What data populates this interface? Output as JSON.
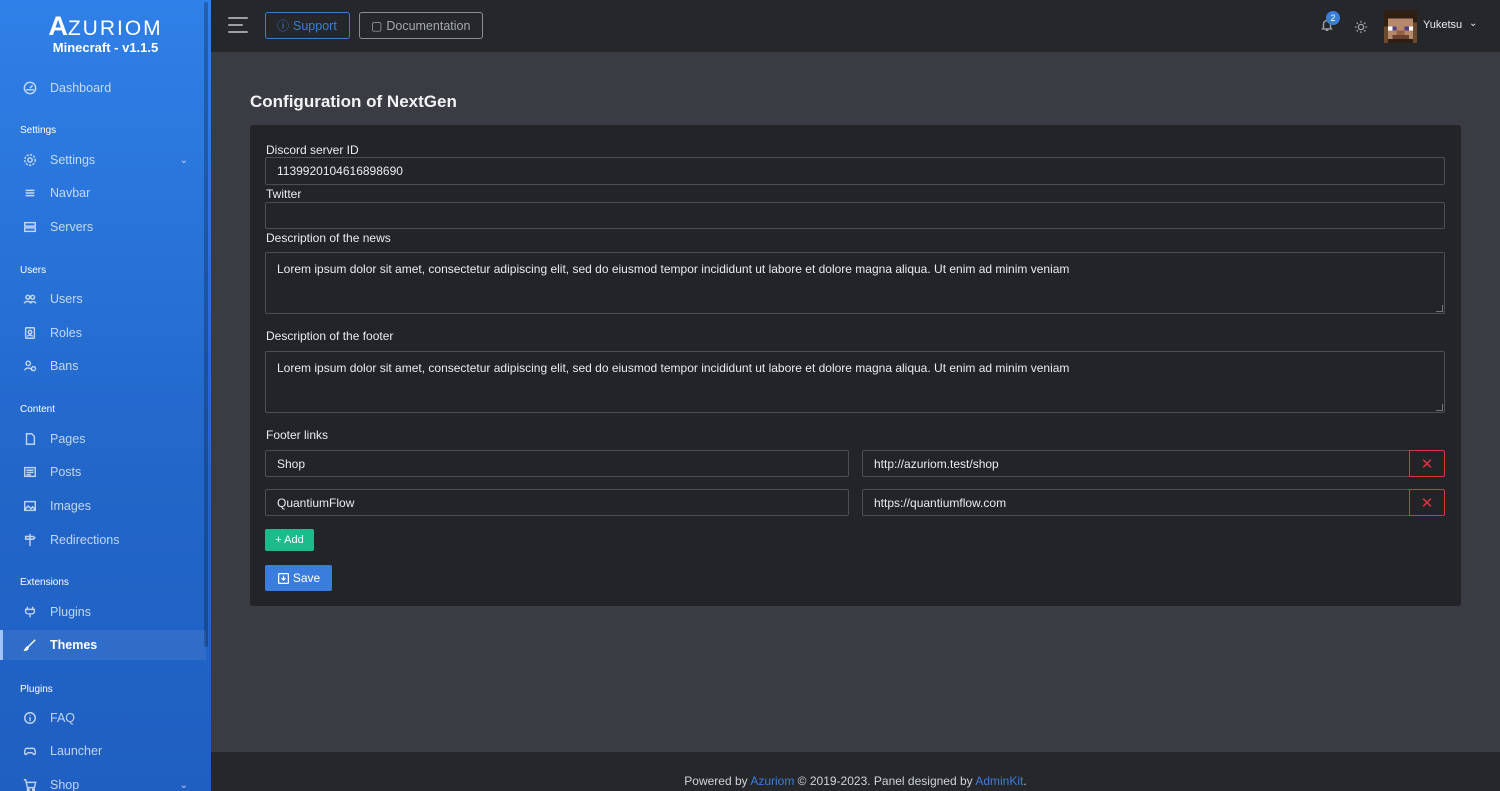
{
  "brand": {
    "logo_first": "A",
    "logo_rest": "ZURIOM",
    "version": "Minecraft - v1.1.5"
  },
  "sidebar": {
    "headers": {
      "settings": "Settings",
      "users": "Users",
      "content": "Content",
      "extensions": "Extensions",
      "plugins": "Plugins"
    },
    "items": [
      {
        "label": "Dashboard",
        "icon": "speedometer-icon"
      },
      {
        "label": "Settings",
        "icon": "gear-icon"
      },
      {
        "label": "Navbar",
        "icon": "list-icon"
      },
      {
        "label": "Servers",
        "icon": "server-icon"
      },
      {
        "label": "Users",
        "icon": "people-icon"
      },
      {
        "label": "Roles",
        "icon": "person-badge-icon"
      },
      {
        "label": "Bans",
        "icon": "person-x-icon"
      },
      {
        "label": "Pages",
        "icon": "file-icon"
      },
      {
        "label": "Posts",
        "icon": "newspaper-icon"
      },
      {
        "label": "Images",
        "icon": "image-icon"
      },
      {
        "label": "Redirections",
        "icon": "signpost-icon"
      },
      {
        "label": "Plugins",
        "icon": "plug-icon"
      },
      {
        "label": "Themes",
        "icon": "brush-icon"
      },
      {
        "label": "FAQ",
        "icon": "info-icon"
      },
      {
        "label": "Launcher",
        "icon": "controller-icon"
      },
      {
        "label": "Shop",
        "icon": "cart-icon"
      }
    ]
  },
  "topbar": {
    "support_label": "Support",
    "documentation_label": "Documentation",
    "notification_count": "2",
    "username": "Yuketsu"
  },
  "main": {
    "title": "Configuration of NextGen",
    "discord_label": "Discord server ID",
    "discord_value": "1139920104616898690",
    "twitter_label": "Twitter",
    "twitter_value": "",
    "news_label": "Description of the news",
    "news_value": "Lorem ipsum dolor sit amet, consectetur adipiscing elit, sed do eiusmod tempor incididunt ut labore et dolore magna aliqua. Ut enim ad minim veniam",
    "footer_desc_label": "Description of the footer",
    "footer_desc_value": "Lorem ipsum dolor sit amet, consectetur adipiscing elit, sed do eiusmod tempor incididunt ut labore et dolore magna aliqua. Ut enim ad minim veniam",
    "footer_links_label": "Footer links",
    "links": [
      {
        "name": "Shop",
        "url": "http://azuriom.test/shop"
      },
      {
        "name": "QuantiumFlow",
        "url": "https://quantiumflow.com"
      }
    ],
    "add_label": "+ Add",
    "save_label": "Save"
  },
  "footer": {
    "prefix": "Powered by ",
    "azuriom": "Azuriom",
    "middle": " © 2019-2023. Panel designed by ",
    "adminkit": "AdminKit",
    "suffix": "."
  },
  "colors": {
    "primary": "#3b7ddd",
    "success": "#1cbb8c",
    "danger": "#dc3545",
    "sidebar": "#2f80e8"
  }
}
